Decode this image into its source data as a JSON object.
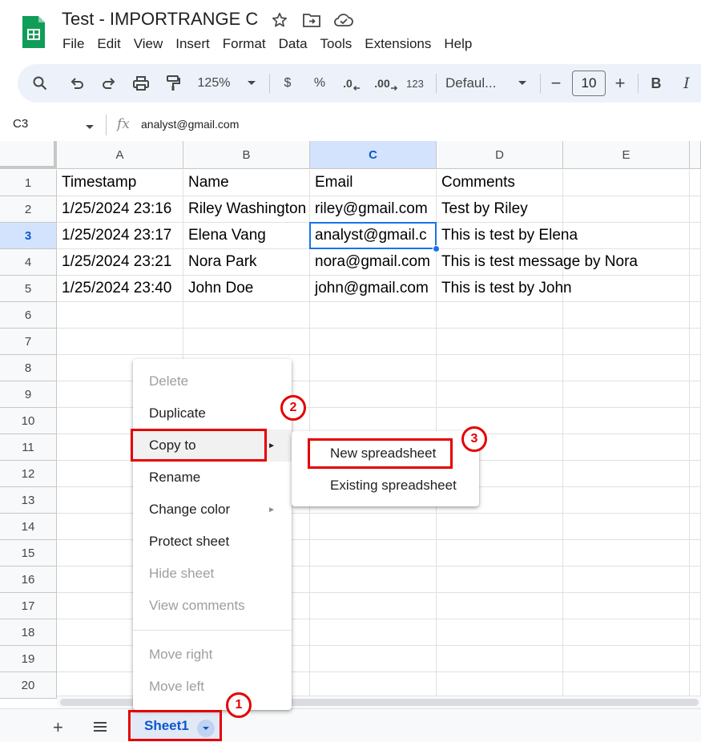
{
  "title": {
    "doc_name": "Test - IMPORTRANGE C",
    "icons": [
      "star-icon",
      "move-folder-icon",
      "cloud-status-icon"
    ]
  },
  "menu": [
    "File",
    "Edit",
    "View",
    "Insert",
    "Format",
    "Data",
    "Tools",
    "Extensions",
    "Help"
  ],
  "toolbar": {
    "zoom": "125%",
    "currency": "$",
    "percent": "%",
    "dec_decrease": ".0",
    "dec_increase": ".00",
    "number_format": "123",
    "font": "Defaul...",
    "font_size": "10",
    "minus": "−",
    "plus": "+",
    "bold": "B",
    "italic": "I"
  },
  "formula_bar": {
    "cell_ref": "C3",
    "fx": "fx",
    "value": "analyst@gmail.com"
  },
  "grid": {
    "columns": [
      "A",
      "B",
      "C",
      "D",
      "E"
    ],
    "selected_column": "C",
    "selected_row": "3",
    "rows": [
      {
        "num": "1",
        "cells": [
          "Timestamp",
          "Name",
          "Email",
          "Comments",
          ""
        ]
      },
      {
        "num": "2",
        "cells": [
          "1/25/2024 23:16",
          "Riley Washington",
          "riley@gmail.com",
          "Test by Riley",
          ""
        ]
      },
      {
        "num": "3",
        "cells": [
          "1/25/2024 23:17",
          "Elena Vang",
          "analyst@gmail.c",
          "This is test by Elena",
          ""
        ]
      },
      {
        "num": "4",
        "cells": [
          "1/25/2024 23:21",
          "Nora Park",
          "nora@gmail.com",
          "This is test message by Nora",
          ""
        ]
      },
      {
        "num": "5",
        "cells": [
          "1/25/2024 23:40",
          "John Doe",
          "john@gmail.com",
          "This is test by John",
          ""
        ]
      },
      {
        "num": "6",
        "cells": [
          "",
          "",
          "",
          "",
          ""
        ]
      },
      {
        "num": "7",
        "cells": [
          "",
          "",
          "",
          "",
          ""
        ]
      },
      {
        "num": "8",
        "cells": [
          "",
          "",
          "",
          "",
          ""
        ]
      },
      {
        "num": "9",
        "cells": [
          "",
          "",
          "",
          "",
          ""
        ]
      },
      {
        "num": "10",
        "cells": [
          "",
          "",
          "",
          "",
          ""
        ]
      },
      {
        "num": "11",
        "cells": [
          "",
          "",
          "",
          "",
          ""
        ]
      },
      {
        "num": "12",
        "cells": [
          "",
          "",
          "",
          "",
          ""
        ]
      },
      {
        "num": "13",
        "cells": [
          "",
          "",
          "",
          "",
          ""
        ]
      },
      {
        "num": "14",
        "cells": [
          "",
          "",
          "",
          "",
          ""
        ]
      },
      {
        "num": "15",
        "cells": [
          "",
          "",
          "",
          "",
          ""
        ]
      },
      {
        "num": "16",
        "cells": [
          "",
          "",
          "",
          "",
          ""
        ]
      },
      {
        "num": "17",
        "cells": [
          "",
          "",
          "",
          "",
          ""
        ]
      },
      {
        "num": "18",
        "cells": [
          "",
          "",
          "",
          "",
          ""
        ]
      },
      {
        "num": "19",
        "cells": [
          "",
          "",
          "",
          "",
          ""
        ]
      },
      {
        "num": "20",
        "cells": [
          "",
          "",
          "",
          "",
          ""
        ]
      }
    ]
  },
  "context_menu": {
    "items": [
      {
        "label": "Delete",
        "disabled": true,
        "submenu": false
      },
      {
        "label": "Duplicate",
        "disabled": false,
        "submenu": false
      },
      {
        "label": "Copy to",
        "disabled": false,
        "submenu": true
      },
      {
        "label": "Rename",
        "disabled": false,
        "submenu": false
      },
      {
        "label": "Change color",
        "disabled": false,
        "submenu": true
      },
      {
        "label": "Protect sheet",
        "disabled": false,
        "submenu": false
      },
      {
        "label": "Hide sheet",
        "disabled": true,
        "submenu": false
      },
      {
        "label": "View comments",
        "disabled": true,
        "submenu": false
      },
      {
        "label": "Move right",
        "disabled": true,
        "submenu": false
      },
      {
        "label": "Move left",
        "disabled": true,
        "submenu": false
      }
    ],
    "submenu_arrow": "►"
  },
  "copy_to_submenu": [
    "New spreadsheet",
    "Existing spreadsheet"
  ],
  "sheets": {
    "add": "+",
    "all_sheets": "≡",
    "active_tab": "Sheet1"
  },
  "annotations": {
    "badges": [
      "1",
      "2",
      "3"
    ],
    "color": "#e50000"
  },
  "colors": {
    "accent": "#0b57d0",
    "selection": "#1a73e8",
    "toolbar_bg": "#edf2fa",
    "header_selected": "#d3e3fd"
  }
}
